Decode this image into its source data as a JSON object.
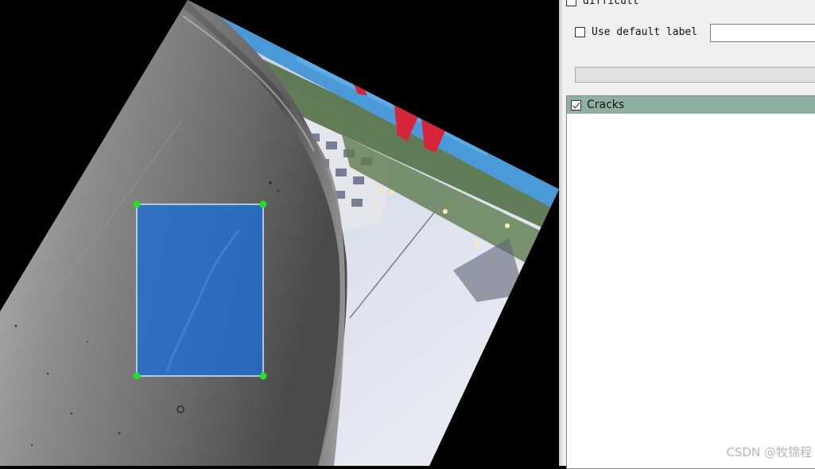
{
  "dock": {
    "difficult_label": "difficult",
    "difficult_checked": false,
    "use_default_label": "Use default label",
    "use_default_checked": false,
    "default_label_value": "",
    "labels": [
      {
        "name": "Cracks",
        "checked": true,
        "selected": true
      }
    ]
  },
  "canvas": {
    "annotation_fill": "#1f6fd0",
    "vertex_color": "#22e022"
  },
  "watermark": "CSDN @牧锦程"
}
